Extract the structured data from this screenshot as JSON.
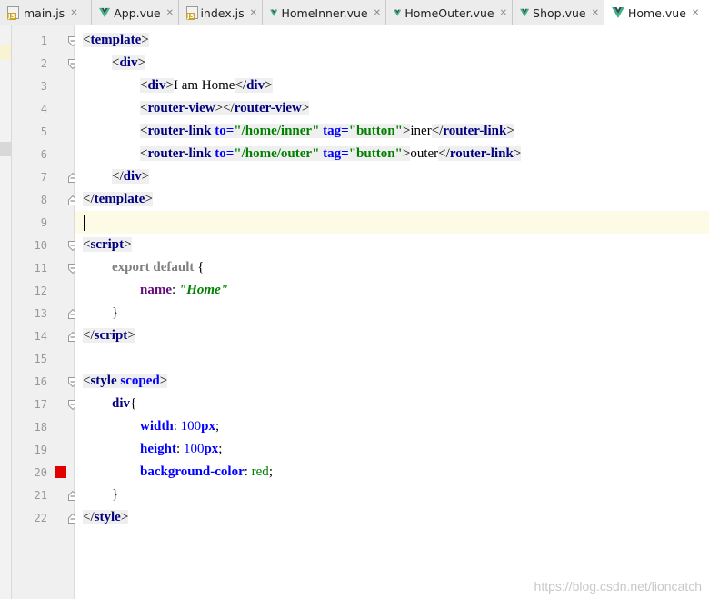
{
  "tabs": [
    {
      "label": "main.js",
      "icon": "js-file-icon",
      "active": false
    },
    {
      "label": "App.vue",
      "icon": "vue-file-icon",
      "active": false
    },
    {
      "label": "index.js",
      "icon": "js-file-icon",
      "active": false
    },
    {
      "label": "HomeInner.vue",
      "icon": "vue-file-icon",
      "active": false
    },
    {
      "label": "HomeOuter.vue",
      "icon": "vue-file-icon",
      "active": false
    },
    {
      "label": "Shop.vue",
      "icon": "vue-file-icon",
      "active": false
    },
    {
      "label": "Home.vue",
      "icon": "vue-file-icon",
      "active": true
    }
  ],
  "tab_close_glyph": "✕",
  "icon_js_text": "JS",
  "line_numbers": [
    "1",
    "2",
    "3",
    "4",
    "5",
    "6",
    "7",
    "8",
    "9",
    "10",
    "11",
    "12",
    "13",
    "14",
    "15",
    "16",
    "17",
    "18",
    "19",
    "20",
    "21",
    "22"
  ],
  "current_line": 9,
  "breakpoint_line": 20,
  "code": {
    "l1": {
      "p1": "<",
      "t": "template",
      "p2": ">"
    },
    "l2": {
      "p1": "<",
      "t": "div",
      "p2": ">"
    },
    "l3": {
      "p1": "<",
      "t": "div",
      "p2": ">",
      "text": "I am Home",
      "p3": "</",
      "t2": "div",
      "p4": ">"
    },
    "l4": {
      "p1": "<",
      "t": "router-view",
      "p2": ">",
      "p3": "</",
      "t2": "router-view",
      "p4": ">"
    },
    "l5": {
      "p1": "<",
      "t": "router-link",
      "a1": " to=",
      "v1": "\"/home/inner\"",
      "a2": " tag=",
      "v2": "\"button\"",
      "p2": ">",
      "text": "iner",
      "p3": "</",
      "t2": "router-link",
      "p4": ">"
    },
    "l6": {
      "p1": "<",
      "t": "router-link",
      "a1": " to=",
      "v1": "\"/home/outer\"",
      "a2": " tag=",
      "v2": "\"button\"",
      "p2": ">",
      "text": "outer",
      "p3": "</",
      "t2": "router-link",
      "p4": ">"
    },
    "l7": {
      "p1": "</",
      "t": "div",
      "p2": ">"
    },
    "l8": {
      "p1": "</",
      "t": "template",
      "p2": ">"
    },
    "l10": {
      "p1": "<",
      "t": "script",
      "p2": ">"
    },
    "l11": {
      "kw": "export default",
      "rest": " {"
    },
    "l12": {
      "prop": "name",
      "colon": ": ",
      "str": "\"Home\""
    },
    "l13": {
      "text": "}"
    },
    "l14": {
      "p1": "</",
      "t": "script",
      "p2": ">"
    },
    "l16": {
      "p1": "<",
      "t": "style",
      "a1": " scoped",
      "p2": ">"
    },
    "l17": {
      "t": "div",
      "rest": "{"
    },
    "l18": {
      "prop": "width",
      "colon": ": ",
      "num": "100",
      "unit": "px",
      "semi": ";"
    },
    "l19": {
      "prop": "height",
      "colon": ": ",
      "num": "100",
      "unit": "px",
      "semi": ";"
    },
    "l20": {
      "prop": "background-color",
      "colon": ": ",
      "val": "red",
      "semi": ";"
    },
    "l21": {
      "text": "}"
    },
    "l22": {
      "p1": "</",
      "t": "style",
      "p2": ">"
    }
  },
  "watermark": "https://blog.csdn.net/lioncatch",
  "colors": {
    "tag": "#000080",
    "attribute": "#0000ff",
    "string": "#008000",
    "keyword": "#808080",
    "property": "#660e7a",
    "current_line": "#fdfbe5",
    "breakpoint": "#e00000",
    "vue_green": "#41b883",
    "vue_dark": "#34495e"
  }
}
